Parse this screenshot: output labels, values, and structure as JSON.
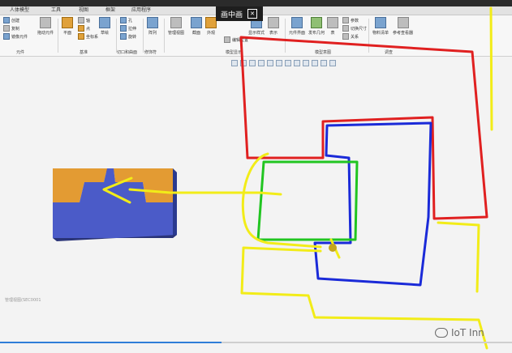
{
  "tabs": [
    "人体模型",
    "工具",
    "视图",
    "框架",
    "应用程序"
  ],
  "ribbon": {
    "items": {
      "create": "创建",
      "copy": "复制",
      "mirror": "镜像元件",
      "drag": "拖动元件",
      "plane": "平面",
      "axis": "轴",
      "point": "点",
      "csys": "坐标系",
      "sketch": "草绘",
      "hole": "孔",
      "extrude": "拉伸",
      "revolve": "旋转",
      "pattern": "阵列",
      "manage_view": "管理视图",
      "section": "截面",
      "appearance": "外观",
      "edit_pos": "编辑位置",
      "display_style": "显示样式",
      "rep": "表示",
      "comp_interface": "元件界面",
      "publish_geom": "发布几何",
      "table": "表",
      "params": "参数",
      "switch_dim": "切换尺寸",
      "relations": "关系",
      "bom": "物料清单",
      "ref_viewer": "参考查看器"
    },
    "groups": [
      "元件",
      "基准",
      "切口和曲面",
      "修饰符",
      "模型显示",
      "模型意图",
      "调查"
    ]
  },
  "pip": {
    "label": "画中画"
  },
  "status": {
    "text": "管理视图(SEC0001"
  },
  "watermark": {
    "text": "IoT Inn"
  },
  "annotation_colors": {
    "red": "#e02020",
    "blue": "#1a2ad8",
    "green": "#21c521",
    "yellow": "#f2ec18"
  },
  "progress": {
    "fraction": 0.43
  }
}
